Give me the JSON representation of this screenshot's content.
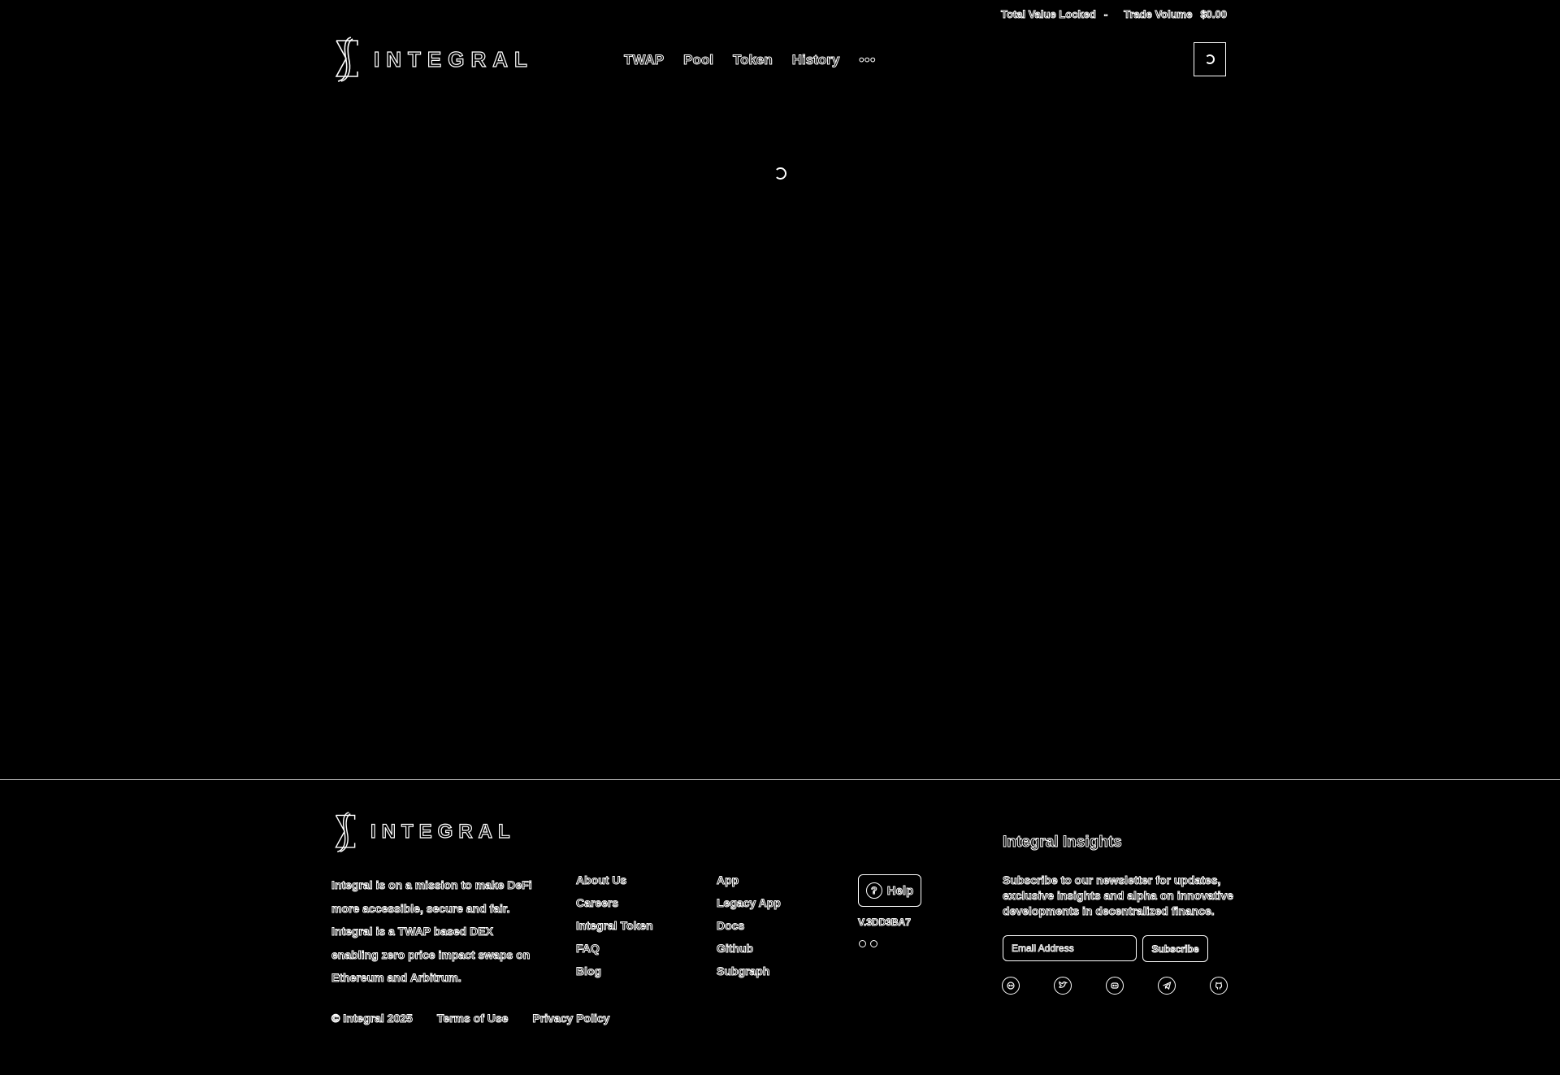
{
  "stats": {
    "tvl_label": "Total Value Locked",
    "tvl_value": "-",
    "volume_label": "Trade Volume",
    "volume_value": "$0.00"
  },
  "brand": {
    "name": "INTEGRAL"
  },
  "nav": {
    "items": [
      {
        "label": "TWAP"
      },
      {
        "label": "Pool"
      },
      {
        "label": "Token"
      },
      {
        "label": "History"
      }
    ],
    "more_label": "•••"
  },
  "icons": {
    "logo": "integral-sigma-logo-icon",
    "wallet": "loading-spinner-icon",
    "help": "help-icon",
    "socials": [
      "discord-icon",
      "twitter-icon",
      "reddit-icon",
      "telegram-icon",
      "github-icon"
    ]
  },
  "footer": {
    "mission": "Integral is on a mission to make DeFi more accessible, secure and fair. Integral is a TWAP based DEX enabling zero price impact swaps on Ethereum and Arbitrum.",
    "links_col1": [
      {
        "label": "About Us"
      },
      {
        "label": "Careers"
      },
      {
        "label": "Integral Token"
      },
      {
        "label": "FAQ"
      },
      {
        "label": "Blog"
      }
    ],
    "links_col2": [
      {
        "label": "App"
      },
      {
        "label": "Legacy App"
      },
      {
        "label": "Docs"
      },
      {
        "label": "Github"
      },
      {
        "label": "Subgraph"
      }
    ],
    "help_label": "Help",
    "version": "V.3DD3BA7",
    "insights_title": "Integral Insights",
    "insights_text": "Subscribe to our newsletter for updates, exclusive insights and alpha on innovative developments in decentralized finance.",
    "email_placeholder": "Email Address",
    "subscribe_label": "Subscribe",
    "copyright": "© Integral 2025",
    "terms_label": "Terms of Use",
    "privacy_label": "Privacy Policy"
  }
}
